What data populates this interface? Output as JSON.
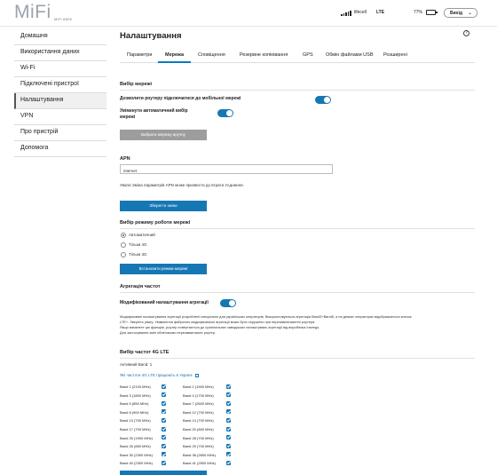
{
  "header": {
    "logo": "MiFi",
    "model": "MiFi 8800",
    "operator": "lifecell",
    "network": "LTE",
    "battery": "77%",
    "logout": "Вихід"
  },
  "sidebar": {
    "items": [
      {
        "label": "Домашня",
        "active": false
      },
      {
        "label": "Використання даних",
        "active": false
      },
      {
        "label": "Wi-Fi",
        "active": false
      },
      {
        "label": "Підключені пристрої",
        "active": false
      },
      {
        "label": "Налаштування",
        "active": true
      },
      {
        "label": "VPN",
        "active": false
      },
      {
        "label": "Про пристрій",
        "active": false
      },
      {
        "label": "Допомога",
        "active": false
      }
    ]
  },
  "page": {
    "title": "Налаштування",
    "help": "?"
  },
  "tabs": [
    {
      "label": "Параметри",
      "active": false
    },
    {
      "label": "Мережа",
      "active": true
    },
    {
      "label": "Сповіщення",
      "active": false
    },
    {
      "label": "Резервне копіювання",
      "active": false
    },
    {
      "label": "GPS",
      "active": false
    },
    {
      "label": "Обмін файлами USB",
      "active": false
    },
    {
      "label": "Розширені",
      "active": false
    }
  ],
  "network_select": {
    "title": "Вибір мережі",
    "allow_label": "Дозволити роутеру підключатися до мобільної мережі",
    "auto_label_1": "Увімкнути автоматичний вибір",
    "auto_label_2": "мережі",
    "select_button": "Вибрати мережу вручну"
  },
  "apn": {
    "title": "APN",
    "value": "internet",
    "note": "Увага! Зміна параметрів APN може призвести до втрати з'єднання.",
    "save_button": "Зберегти зміни"
  },
  "mode": {
    "title": "Вибір режиму роботи мережі",
    "options": [
      {
        "label": "Автоматичний",
        "selected": true
      },
      {
        "label": "Тільки 4G",
        "selected": false
      },
      {
        "label": "Тільки 3G",
        "selected": false
      }
    ],
    "set_button": "Встановити режим мережі"
  },
  "aggregation": {
    "title": "Агрегація частот",
    "toggle_label": "Модифікований налаштування агрегації",
    "desc_1": "Модифіковані налаштування агрегації розроблені спеціально для українських операторів. Використовуються агрегація Band3+Band8, а на деяких операторах відображається значок",
    "desc_2": "LTE+. Зверніть увагу: Увімкнення фабрично модифікованої агрегації може бути порушено при перезавантаженні роутера.",
    "desc_3": "Якщо вимкнете цю функцію, роутер повертається до оригінальних заводських налаштувань агрегації від виробника Inseego.",
    "desc_4": "Для застосування змін обов'язково перезавантажте роутер."
  },
  "bands": {
    "title": "Вибір частот 4G LTE",
    "active": "Активний Band: 1",
    "link": "Які частоти 4G LTE працюють в Україні",
    "left": [
      "Band 1 (2100 MHz)",
      "Band 3 (1800 MHz)",
      "Band 5 (850 MHz)",
      "Band 8 (900 MHz)",
      "Band 13 (700 MHz)",
      "Band 17 (700 MHz)",
      "Band 25 (1900 MHz)",
      "Band 26 (850 MHz)",
      "Band 30 (2300 MHz)",
      "Band 40 (2300 MHz)"
    ],
    "right": [
      "Band 2 (1900 MHz)",
      "Band 4 (1700 MHz)",
      "Band 7 (2600 MHz)",
      "Band 12 (700 MHz)",
      "Band 14 (700 MHz)",
      "Band 20 (800 MHz)",
      "Band 28 (700 MHz)",
      "Band 29 (700 MHz)",
      "Band 38 (2600 MHz)",
      "Band 41 (2500 MHz)"
    ]
  },
  "colors": {
    "accent": "#1677b5",
    "button_disabled": "#9d9d9d"
  }
}
